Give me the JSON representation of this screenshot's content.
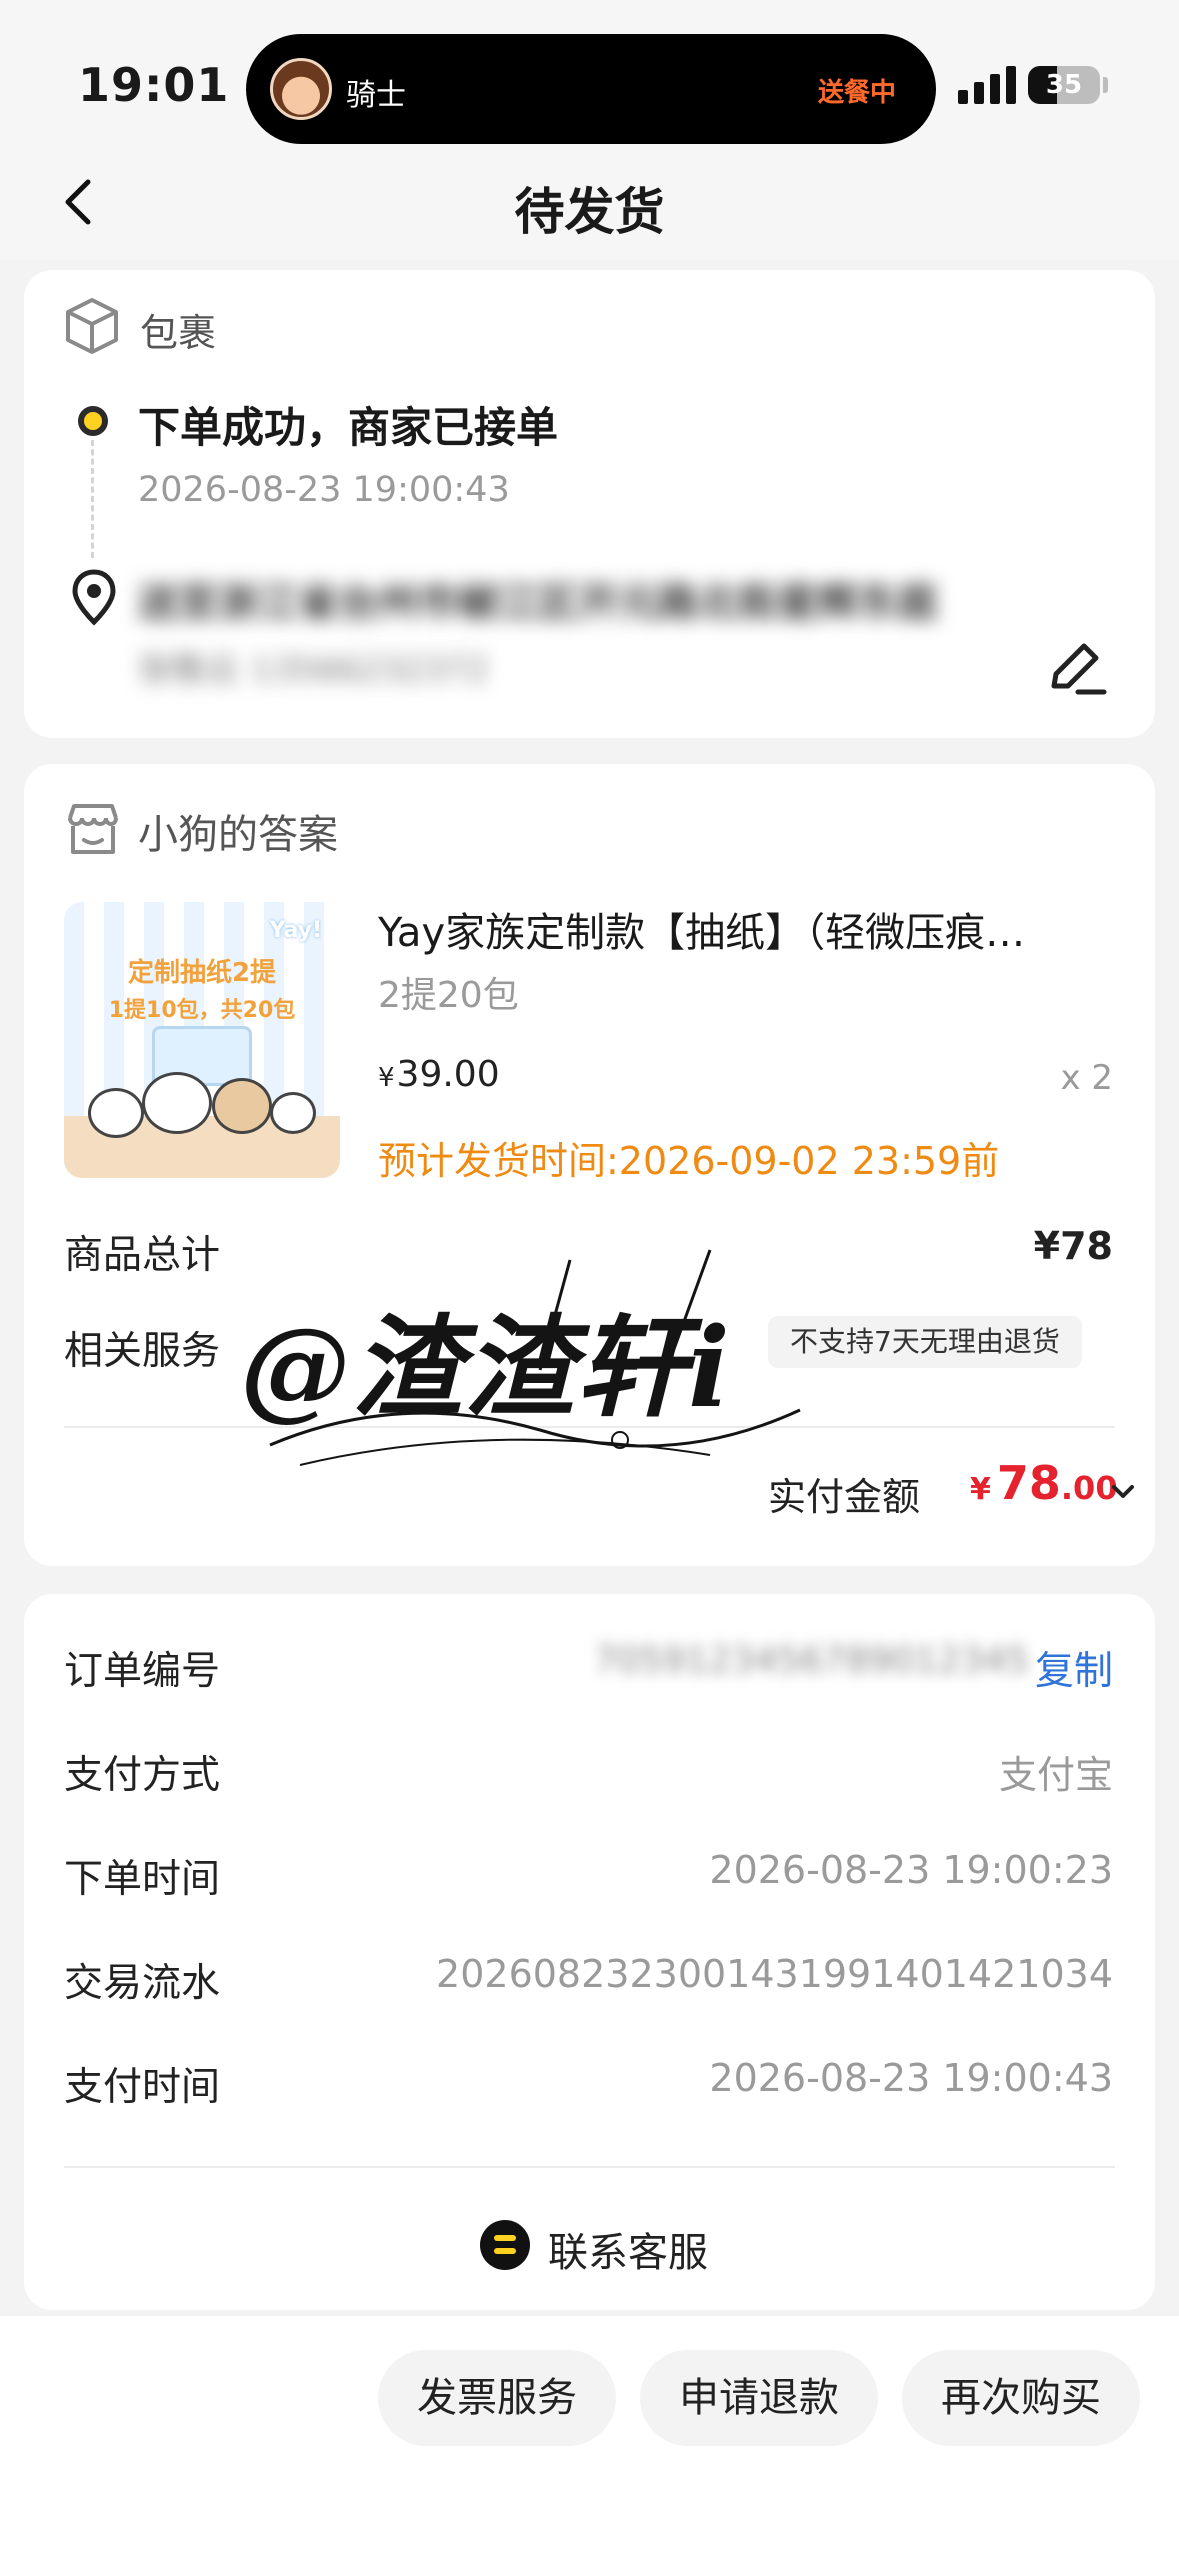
{
  "status_bar": {
    "time": "19:01",
    "rider_name": "骑士",
    "rider_status": "送餐中",
    "battery": "35"
  },
  "nav": {
    "title": "待发货"
  },
  "package": {
    "title": "包裹",
    "status": "下单成功，商家已接单",
    "time": "2026-08-23 19:00:43",
    "address": "送至浙江省台州市椒江区开元路北街星辉东庭",
    "contact": "张敬云 13566232372"
  },
  "goods": {
    "shop_name": "小狗的答案",
    "product_image": {
      "title": "定制抽纸2提",
      "subtitle": "1提10包，共20包",
      "brand": "Yay!"
    },
    "product_name": "Yay家族定制款【抽纸】（轻微压痕…",
    "spec": "2提20包",
    "price_symbol": "¥",
    "price": "39.00",
    "quantity": "x 2",
    "ship_time": "预计发货时间:2026-09-02 23:59前",
    "total_label": "商品总计",
    "total_value": "¥78",
    "service_label": "相关服务",
    "service_tag": "不支持7天无理由退货",
    "paid_label": "实付金额",
    "paid_currency": "¥",
    "paid_int": "78",
    "paid_dec": ".00"
  },
  "watermark": {
    "text": "@渣渣轩i"
  },
  "order_info": {
    "order_no_label": "订单编号",
    "order_no": "7059123456789012345",
    "copy_label": "复制",
    "pay_method_label": "支付方式",
    "pay_method": "支付宝",
    "order_time_label": "下单时间",
    "order_time": "2026-08-23 19:00:23",
    "trade_no_label": "交易流水",
    "trade_no": "2026082323001431991401421034",
    "pay_time_label": "支付时间",
    "pay_time": "2026-08-23 19:00:43",
    "contact_service": "联系客服"
  },
  "bottom_actions": {
    "invoice": "发票服务",
    "refund": "申请退款",
    "rebuy": "再次购买"
  },
  "colors": {
    "accent_orange": "#ef8a12",
    "price_red": "#e5232e",
    "link_blue": "#2f74d9",
    "track_yellow": "#ffd21f"
  }
}
